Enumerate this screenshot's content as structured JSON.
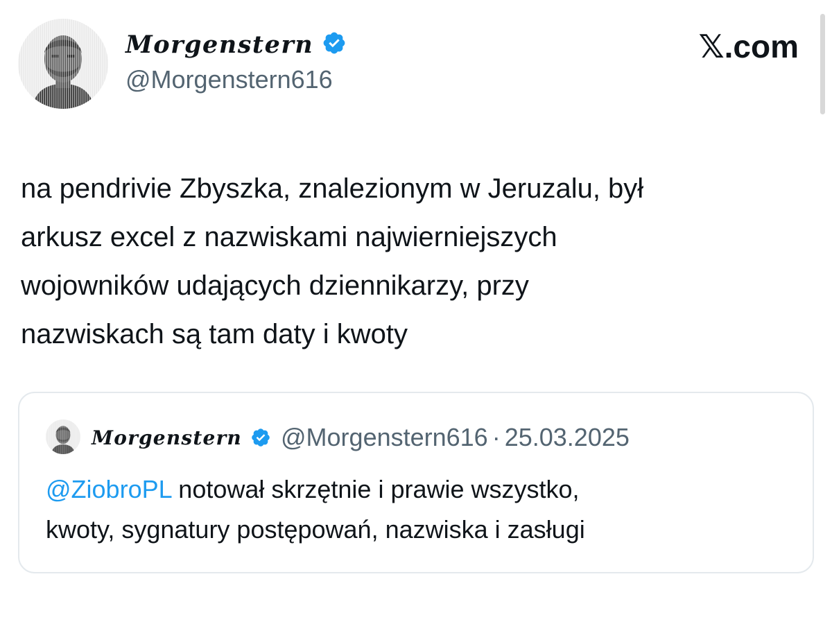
{
  "brand": {
    "label": "𝕏.com"
  },
  "author": {
    "display_name": "Morgenstern",
    "handle": "@Morgenstern616",
    "verified_icon": "verified-badge-icon",
    "avatar_icon": "avatar-photo"
  },
  "tweet": {
    "lines": [
      "na pendrivie Zbyszka, znalezionym w Jeruzalu, był",
      "arkusz excel z nazwiskami najwierniejszych",
      "wojowników udających dziennikarzy, przy",
      "nazwiskach są tam daty i kwoty"
    ]
  },
  "quoted": {
    "display_name": "Morgenstern",
    "handle": "@Morgenstern616",
    "separator": "·",
    "date": "25.03.2025",
    "mention": "@ZiobroPL",
    "line1_rest": " notował skrzętnie i prawie wszystko,",
    "line2": "kwoty, sygnatury postępowań, nazwiska i zasługi"
  },
  "colors": {
    "accent": "#1d9bf0",
    "text": "#0f1419",
    "muted": "#536471",
    "border": "#e4e9ed",
    "background": "#ffffff"
  }
}
